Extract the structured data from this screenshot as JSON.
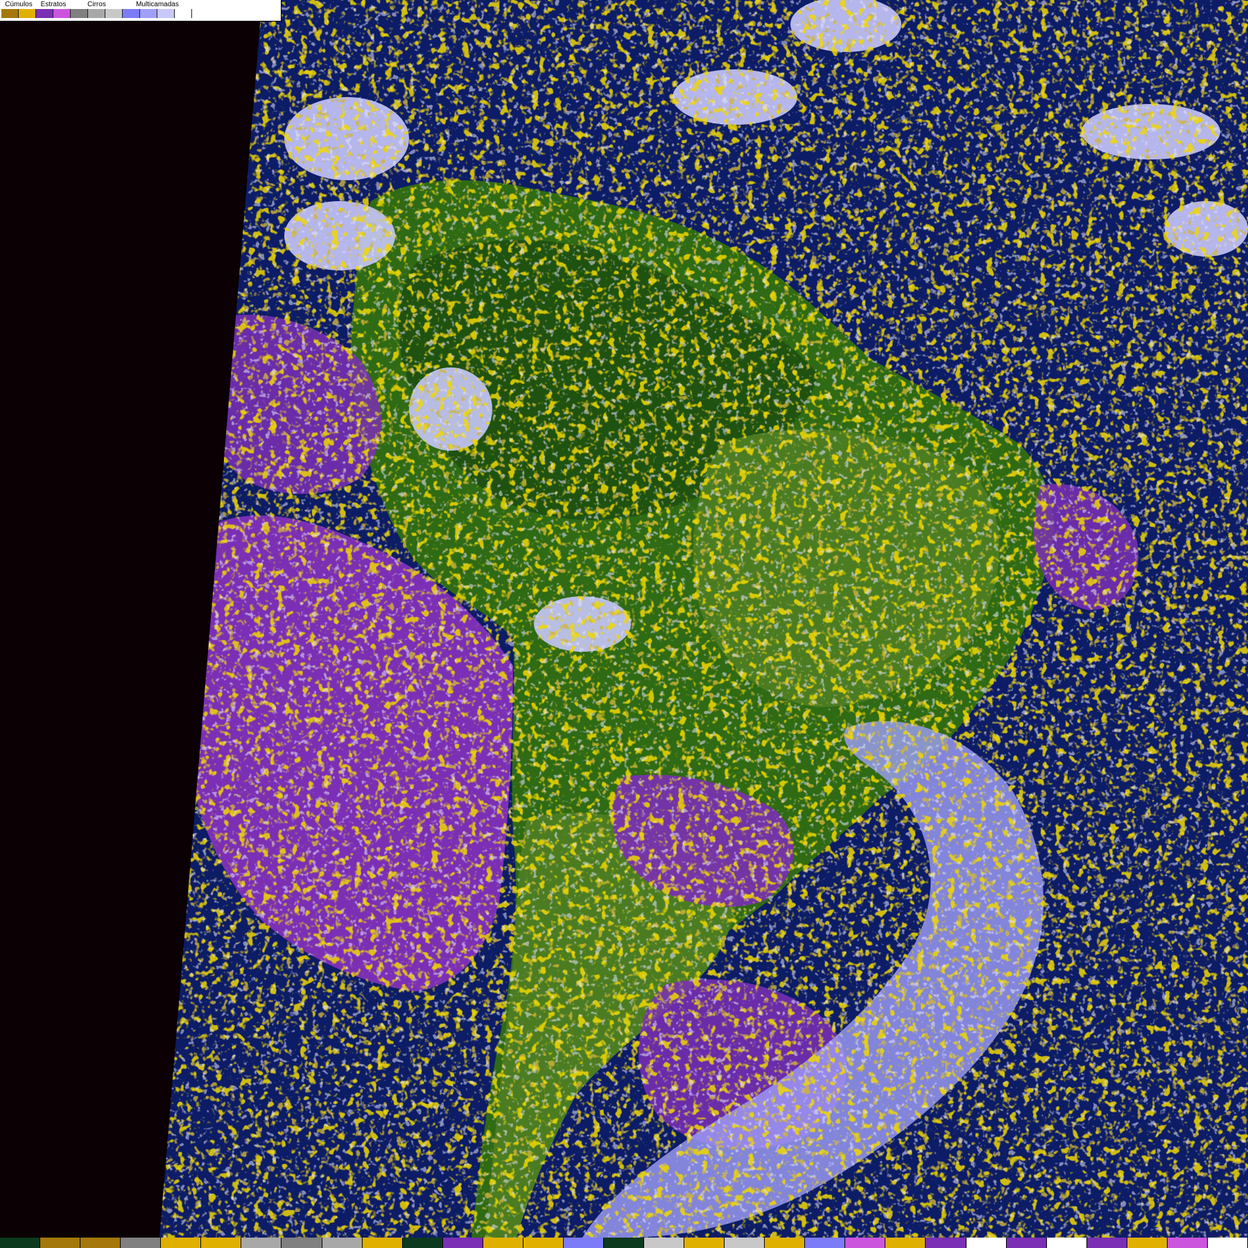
{
  "legend": {
    "groups": [
      {
        "label": "Cúmulos",
        "colors": [
          "#a4780a",
          "#e0b000"
        ]
      },
      {
        "label": "Estratos",
        "colors": [
          "#7b2fb5",
          "#cc55dd"
        ]
      },
      {
        "label": "Cirros",
        "colors": [
          "#808080",
          "#a8a8a8",
          "#c8c8c8"
        ]
      },
      {
        "label": "Multicamadas",
        "colors": [
          "#7c7cf8",
          "#a0a0f8",
          "#c8c8fb",
          "#ffffff"
        ]
      }
    ]
  },
  "colors": {
    "background": "#0b0003",
    "ocean": "#0c1c66",
    "land_forest": "#2f6a14",
    "land_dense_forest": "#1f5210",
    "land_dry": "#4b7c22",
    "cumulus_low": "#a4780a",
    "cumulus_high": "#e0b000",
    "stratus_dark": "#7b2fb5",
    "stratus_light": "#cc55dd",
    "cirrus_dark": "#808080",
    "cirrus_mid": "#a8a8a8",
    "cirrus_light": "#c8c8c8",
    "multi_1": "#7c7cf8",
    "multi_2": "#a0a0f8",
    "multi_3": "#c8c8fb",
    "multi_4": "#ffffff"
  },
  "bottom_bar": [
    "#0c3a1e",
    "#a4780a",
    "#a4780a",
    "#808080",
    "#e0b000",
    "#e0b000",
    "#a8a8a8",
    "#808080",
    "#a8a8a8",
    "#e0b000",
    "#0c3a1e",
    "#7b2fb5",
    "#e0b000",
    "#e0b000",
    "#7c7cf8",
    "#0c3a1e",
    "#c8c8c8",
    "#e0b000",
    "#c8c8c8",
    "#e0b000",
    "#7c7cf8",
    "#cc55dd",
    "#e0b000",
    "#7b2fb5",
    "#ffffff",
    "#7b2fb5",
    "#ffffff",
    "#7b2fb5",
    "#e0b000",
    "#cc55dd",
    "#ffffff"
  ]
}
